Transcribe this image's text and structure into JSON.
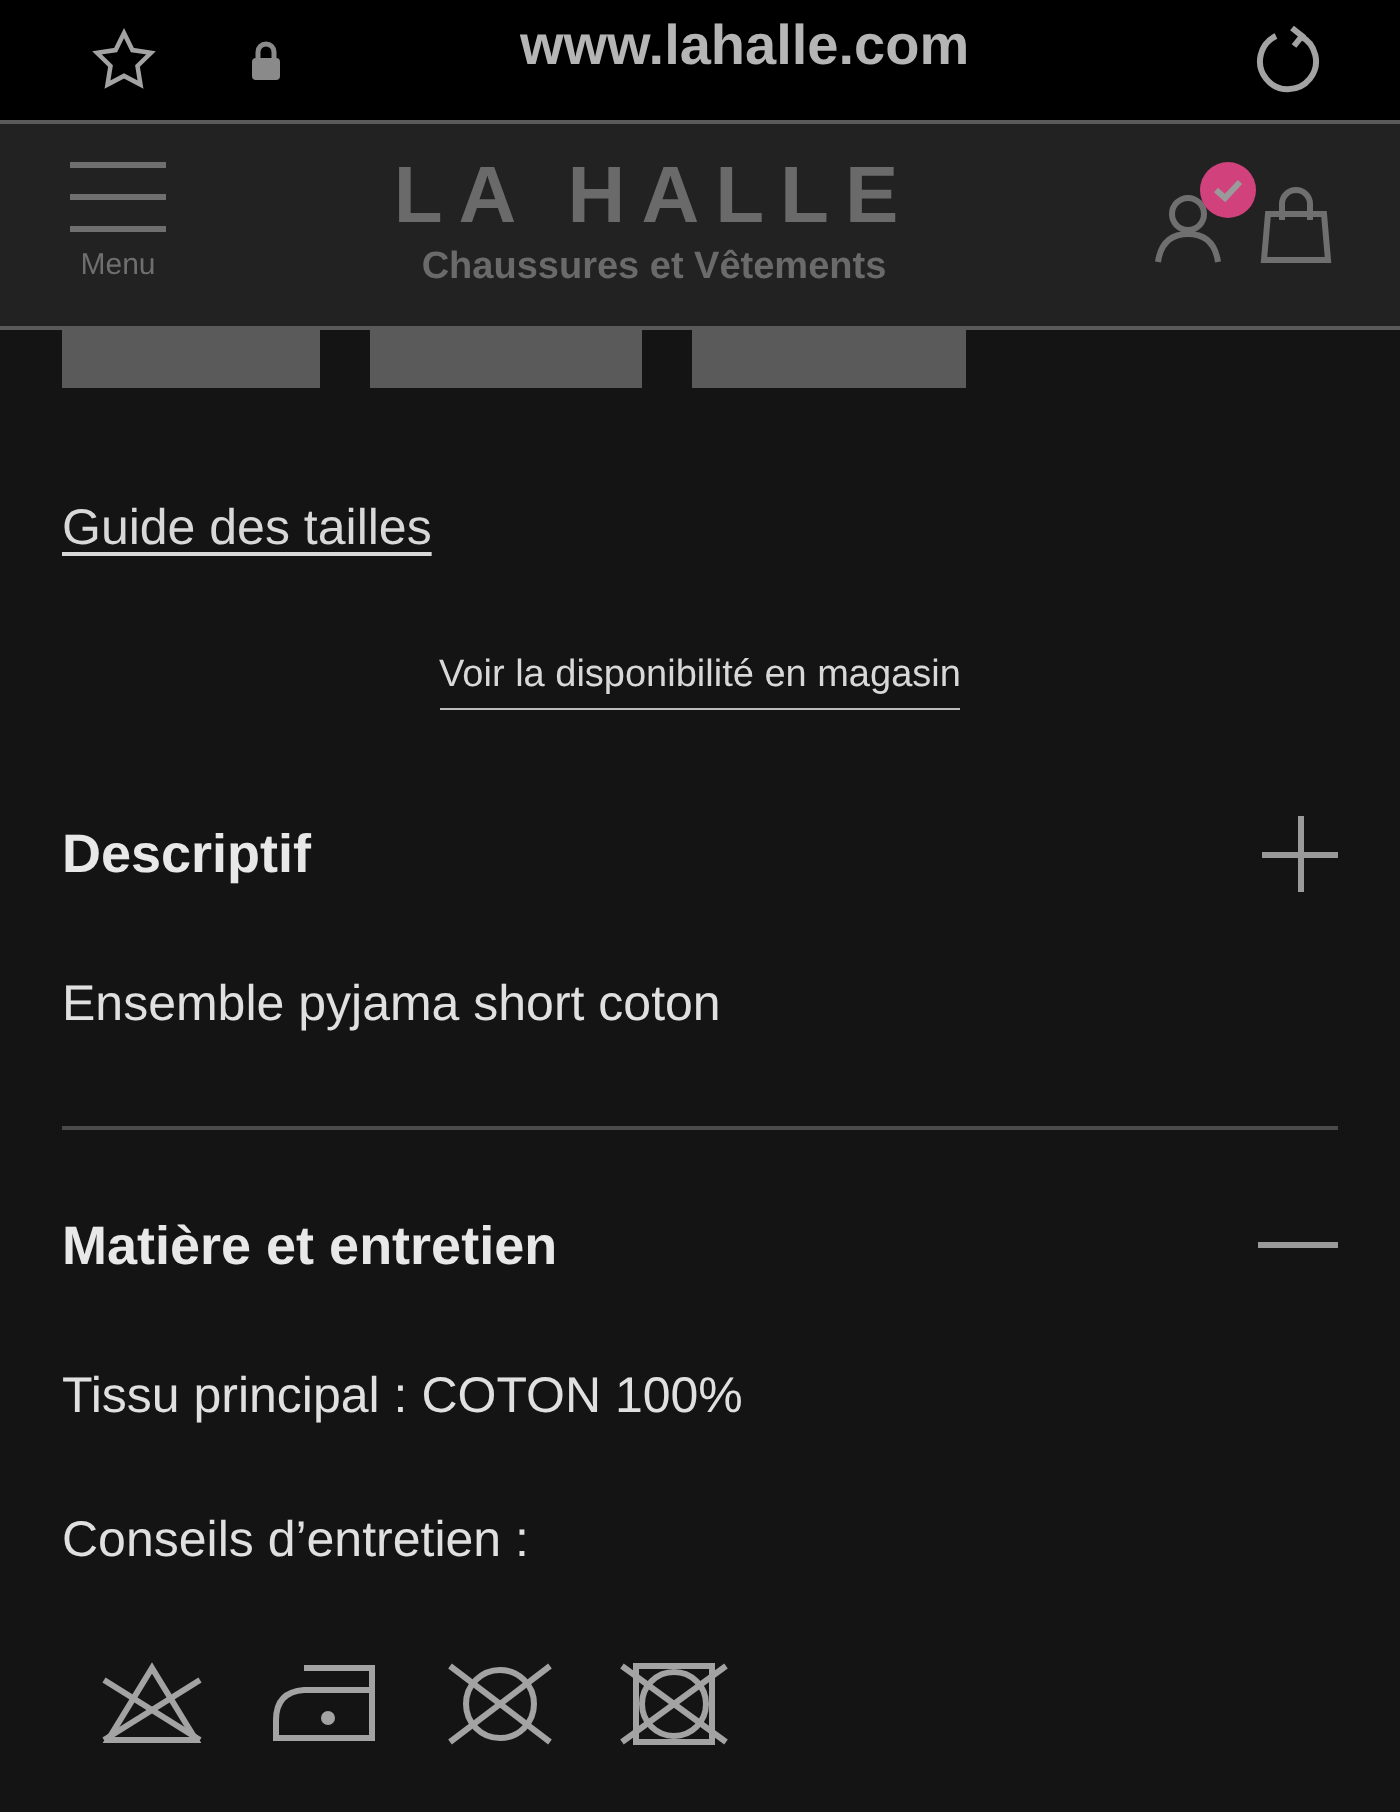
{
  "browser": {
    "url": "www.lahalle.com"
  },
  "header": {
    "menu_label": "Menu",
    "logo": "LA HALLE",
    "tagline": "Chaussures et Vêtements",
    "account_signed_in": true
  },
  "sizes": [
    {
      "kind": "size"
    },
    {
      "kind": "size"
    },
    {
      "kind": "size"
    }
  ],
  "size_guide_link": "Guide des tailles",
  "store_availability_link": "Voir la disponibilité en magasin",
  "sections": [
    {
      "title": "Descriptif",
      "expanded": false,
      "lines": [
        "Ensemble pyjama short coton"
      ]
    },
    {
      "title": "Matière et entretien",
      "expanded": true,
      "lines": [
        "Tissu principal : COTON 100%",
        "Conseils d’entretien :"
      ]
    }
  ],
  "care_icons": [
    {
      "kind": "no-bleach"
    },
    {
      "kind": "iron"
    },
    {
      "kind": "no-dry-clean"
    },
    {
      "kind": "no-tumble-dry"
    }
  ]
}
